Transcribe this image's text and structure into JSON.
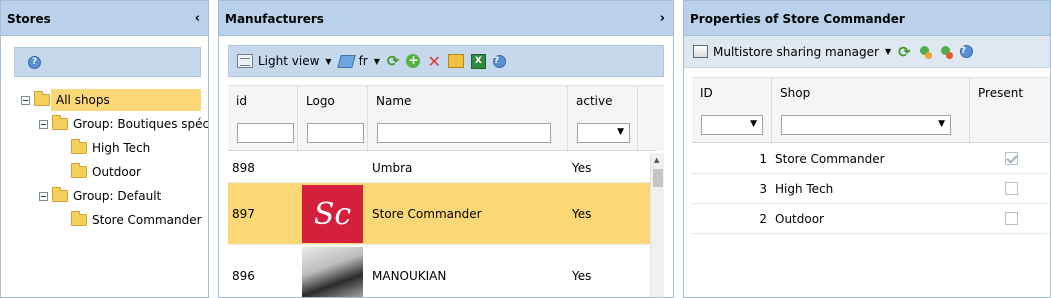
{
  "stores": {
    "title": "Stores",
    "collapse_glyph": "‹",
    "tree": [
      {
        "label": "All shops",
        "level": 0,
        "toggle": true,
        "selected": true
      },
      {
        "label": "Group: Boutiques spécia",
        "level": 1,
        "toggle": true,
        "selected": false
      },
      {
        "label": "High Tech",
        "level": 2,
        "toggle": false,
        "selected": false
      },
      {
        "label": "Outdoor",
        "level": 2,
        "toggle": false,
        "selected": false
      },
      {
        "label": "Group: Default",
        "level": 1,
        "toggle": true,
        "selected": false
      },
      {
        "label": "Store Commander",
        "level": 2,
        "toggle": false,
        "selected": false
      }
    ]
  },
  "manufacturers": {
    "title": "Manufacturers",
    "expand_glyph": "›",
    "toolbar": {
      "view_label": "Light view",
      "lang_label": "fr"
    },
    "columns": {
      "id": "id",
      "logo": "Logo",
      "name": "Name",
      "active": "active"
    },
    "rows": [
      {
        "id": "898",
        "name": "Umbra",
        "active": "Yes",
        "logo": "none",
        "selected": false
      },
      {
        "id": "897",
        "name": "Store Commander",
        "active": "Yes",
        "logo": "sc",
        "logo_text": "Sc",
        "selected": true
      },
      {
        "id": "896",
        "name": "MANOUKIAN",
        "active": "Yes",
        "logo": "photo",
        "selected": false
      }
    ]
  },
  "properties": {
    "title": "Properties of Store Commander",
    "toolbar": {
      "multistore_label": "Multistore sharing manager"
    },
    "columns": {
      "id": "ID",
      "shop": "Shop",
      "present": "Present"
    },
    "rows": [
      {
        "id": "1",
        "shop": "Store Commander",
        "present": true
      },
      {
        "id": "3",
        "shop": "High Tech",
        "present": false
      },
      {
        "id": "2",
        "shop": "Outdoor",
        "present": false
      }
    ]
  },
  "colors": {
    "header_bg": "#b9d1ea",
    "selection": "#fbd776",
    "sc_brand": "#d41f3d"
  }
}
